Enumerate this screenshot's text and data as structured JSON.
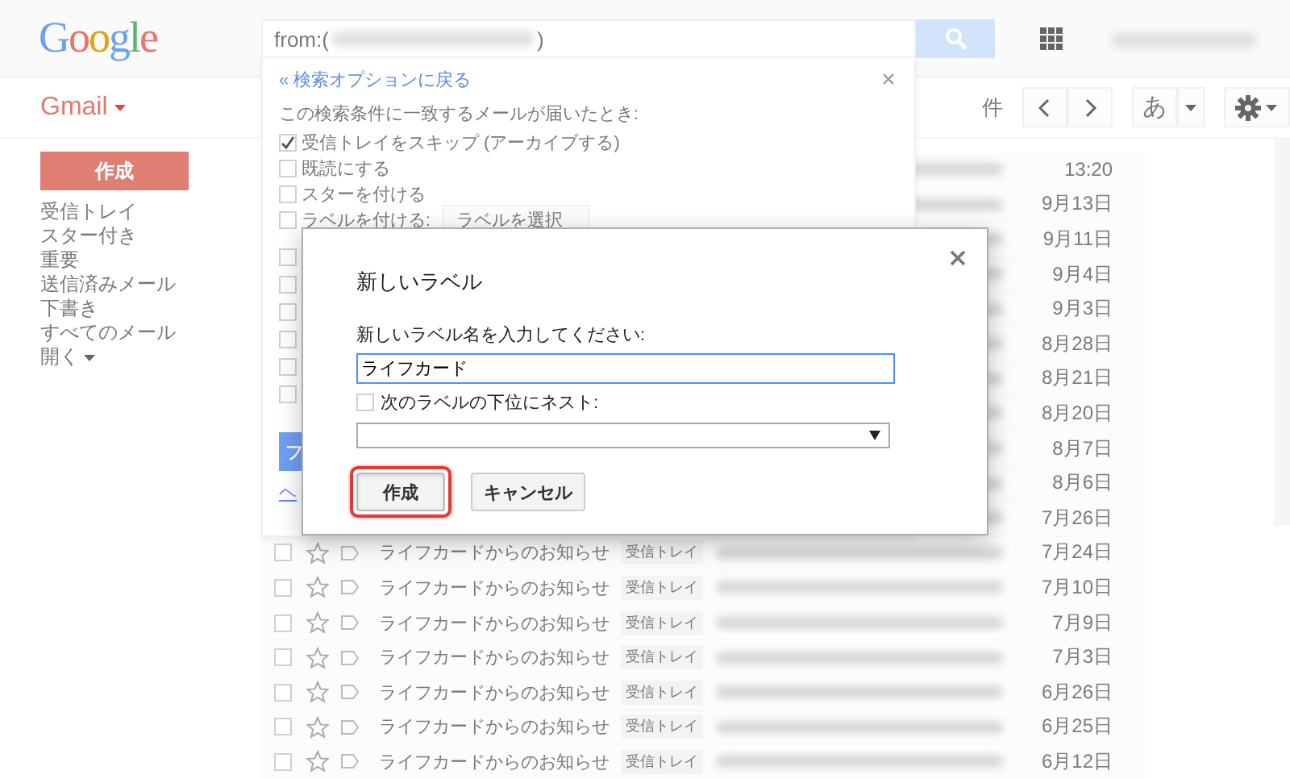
{
  "header": {
    "logo": "Google",
    "search": {
      "query_start": "from:(",
      "query_end": ")"
    }
  },
  "toolbar": {
    "app_menu": "Gmail",
    "count": "件",
    "input_tool": "あ"
  },
  "sidebar": {
    "compose": "作成",
    "folders": [
      {
        "label": "受信トレイ",
        "has_menu": false
      },
      {
        "label": "スター付き",
        "has_menu": false
      },
      {
        "label": "重要",
        "has_menu": false
      },
      {
        "label": "送信済みメール",
        "has_menu": false
      },
      {
        "label": "下書き",
        "has_menu": false
      },
      {
        "label": "すべてのメール",
        "has_menu": false
      },
      {
        "label": "開く",
        "has_menu": true
      }
    ]
  },
  "filter_panel": {
    "back_link": "« 検索オプションに戻る",
    "heading": "この検索条件に一致するメールが届いたとき:",
    "options": [
      {
        "label": "受信トレイをスキップ (アーカイブする)",
        "checked": true
      },
      {
        "label": "既読にする",
        "checked": false
      },
      {
        "label": "スターを付ける",
        "checked": false
      }
    ],
    "label_option": {
      "label": "ラベルを付ける:",
      "select": "ラベルを選択",
      "checked": false
    },
    "hidden_options": [
      {
        "checked": false
      },
      {
        "checked": false
      },
      {
        "checked": false
      },
      {
        "checked": false
      },
      {
        "checked": false
      },
      {
        "checked": false
      }
    ],
    "create_button": "フ",
    "help_link": "ヘ"
  },
  "mails": [
    {
      "date": "13:20"
    },
    {
      "date": "9月13日"
    },
    {
      "date": "9月11日"
    },
    {
      "date": "9月4日"
    },
    {
      "date": "9月3日"
    },
    {
      "date": "8月28日"
    },
    {
      "date": "8月21日"
    },
    {
      "date": "8月20日"
    },
    {
      "date": "8月7日"
    },
    {
      "date": "8月6日"
    },
    {
      "date": "7月26日"
    },
    {
      "date": "7月24日",
      "sender": "ライフカードからのお知らせ",
      "label": "受信トレイ",
      "starred": false,
      "checked": false
    },
    {
      "date": "7月10日",
      "sender": "ライフカードからのお知らせ",
      "label": "受信トレイ",
      "starred": false,
      "checked": false
    },
    {
      "date": "7月9日",
      "sender": "ライフカードからのお知らせ",
      "label": "受信トレイ",
      "starred": false,
      "checked": false
    },
    {
      "date": "7月3日",
      "sender": "ライフカードからのお知らせ",
      "label": "受信トレイ",
      "starred": false,
      "checked": false
    },
    {
      "date": "6月26日",
      "sender": "ライフカードからのお知らせ",
      "label": "受信トレイ",
      "starred": false,
      "checked": false
    },
    {
      "date": "6月25日",
      "sender": "ライフカードからのお知らせ",
      "label": "受信トレイ",
      "starred": false,
      "checked": false
    },
    {
      "date": "6月12日",
      "sender": "ライフカードからのお知らせ",
      "label": "受信トレイ",
      "starred": false,
      "checked": false
    }
  ],
  "dialog": {
    "title": "新しいラベル",
    "prompt": "新しいラベル名を入力してください:",
    "name_value": "ライフカード",
    "nest": {
      "label": "次のラベルの下位にネスト:",
      "checked": false
    },
    "buttons": [
      {
        "label": "作成",
        "highlighted": true
      },
      {
        "label": "キャンセル",
        "highlighted": false
      }
    ]
  }
}
